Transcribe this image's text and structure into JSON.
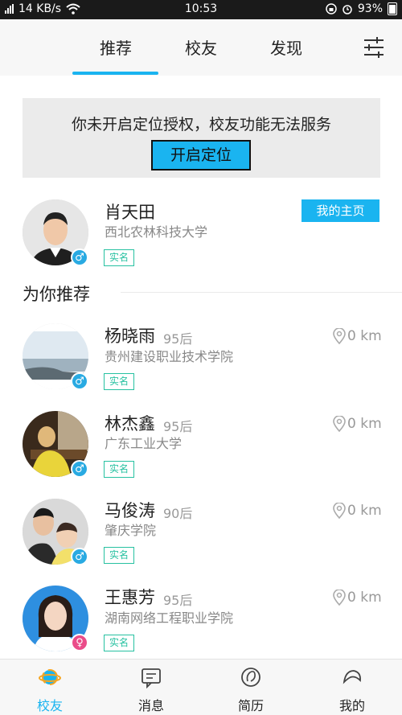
{
  "status_bar": {
    "network": "4G",
    "speed": "14 KB/s",
    "time": "10:53",
    "battery": "93%"
  },
  "top_tabs": [
    {
      "label": "推荐",
      "active": true
    },
    {
      "label": "校友",
      "active": false
    },
    {
      "label": "发现",
      "active": false
    }
  ],
  "location_banner": {
    "message": "你未开启定位授权，校友功能无法服务",
    "button_label": "开启定位"
  },
  "my_profile": {
    "name": "肖天田",
    "school": "西北农林科技大学",
    "badge": "实名",
    "gender": "male",
    "home_button": "我的主页"
  },
  "recommend_section": {
    "title": "为你推荐"
  },
  "recommendations": [
    {
      "name": "杨晓雨",
      "age_group": "95后",
      "school": "贵州建设职业技术学院",
      "badge": "实名",
      "distance": "0 km",
      "gender": "male"
    },
    {
      "name": "林杰鑫",
      "age_group": "95后",
      "school": "广东工业大学",
      "badge": "实名",
      "distance": "0 km",
      "gender": "male"
    },
    {
      "name": "马俊涛",
      "age_group": "90后",
      "school": "肇庆学院",
      "badge": "实名",
      "distance": "0 km",
      "gender": "male"
    },
    {
      "name": "王惠芳",
      "age_group": "95后",
      "school": "湖南网络工程职业学院",
      "badge": "实名",
      "distance": "0 km",
      "gender": "female"
    }
  ],
  "bottom_nav": [
    {
      "label": "校友",
      "icon": "planet-icon",
      "active": true
    },
    {
      "label": "消息",
      "icon": "message-icon",
      "active": false
    },
    {
      "label": "简历",
      "icon": "resume-icon",
      "active": false
    },
    {
      "label": "我的",
      "icon": "profile-icon",
      "active": false
    }
  ],
  "colors": {
    "accent": "#1ab4f0",
    "badge": "#27c1a1",
    "male": "#29aae2",
    "female": "#ea4c89"
  }
}
